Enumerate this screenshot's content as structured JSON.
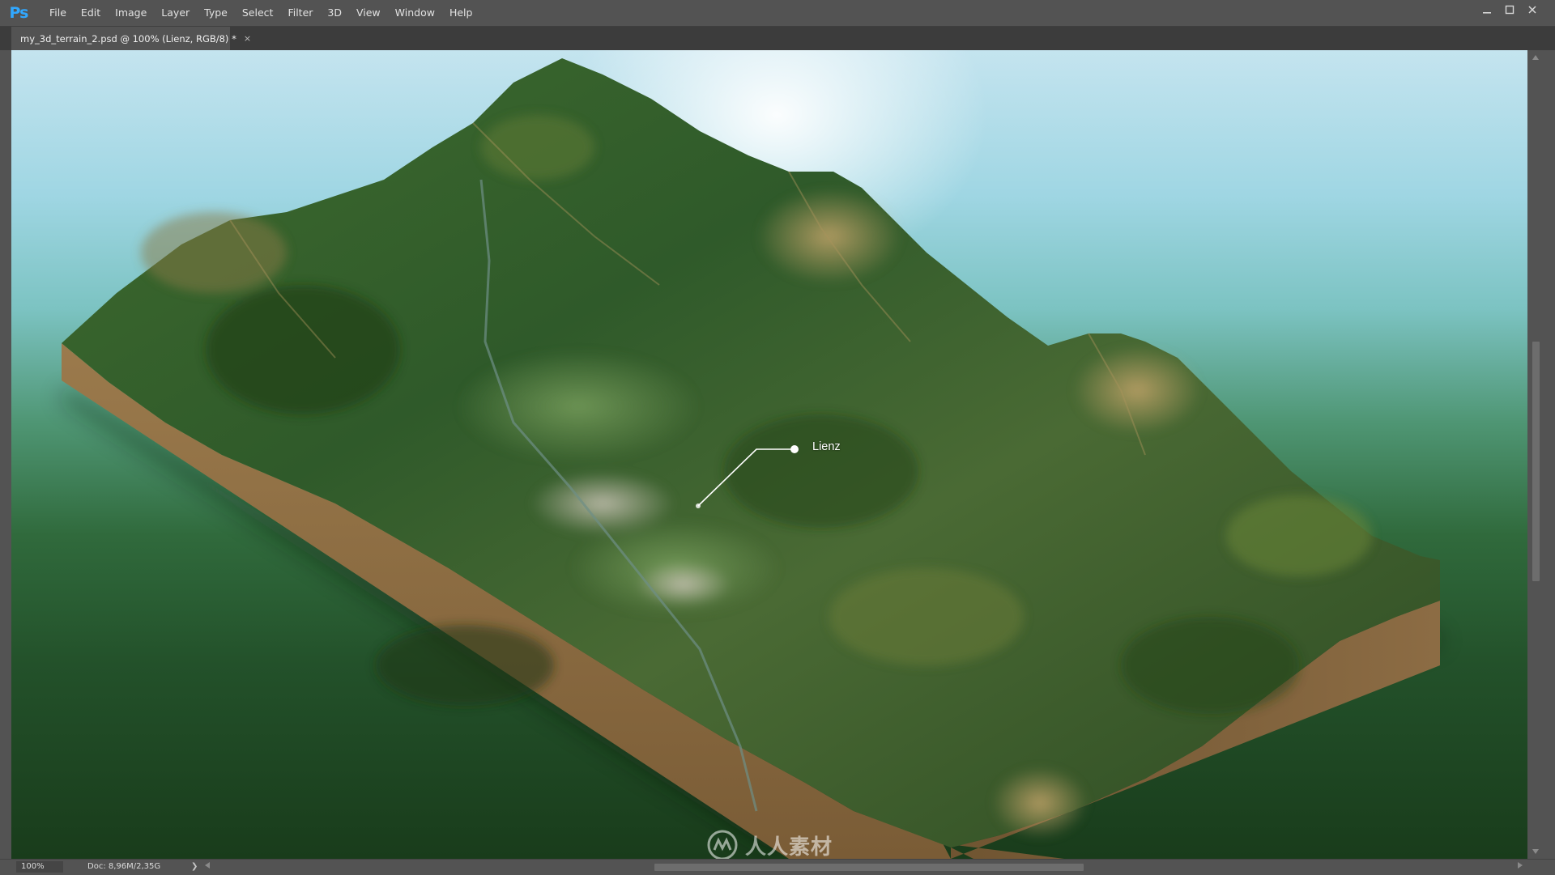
{
  "app": {
    "logo_text": "Ps",
    "menu": [
      "File",
      "Edit",
      "Image",
      "Layer",
      "Type",
      "Select",
      "Filter",
      "3D",
      "View",
      "Window",
      "Help"
    ]
  },
  "document": {
    "tab_title": "my_3d_terrain_2.psd @ 100% (Lienz, RGB/8) *",
    "tab_close": "×"
  },
  "canvas": {
    "location_label": "Lienz",
    "watermark_text": "人人素材"
  },
  "status": {
    "zoom": "100%",
    "doc_info": "Doc: 8,96M/2,35G",
    "arrow": "❯"
  },
  "colors": {
    "photoshop_blue": "#31a8ff",
    "ui_dark": "#535353",
    "tab_bar": "#3c3c3c",
    "terrain_base": "#8c6c44"
  },
  "icons": {
    "minimize": "minimize-icon",
    "maximize": "maximize-icon",
    "close": "close-icon",
    "label_marker": "location-pin-icon",
    "watermark_logo": "watermark-logo-icon"
  }
}
